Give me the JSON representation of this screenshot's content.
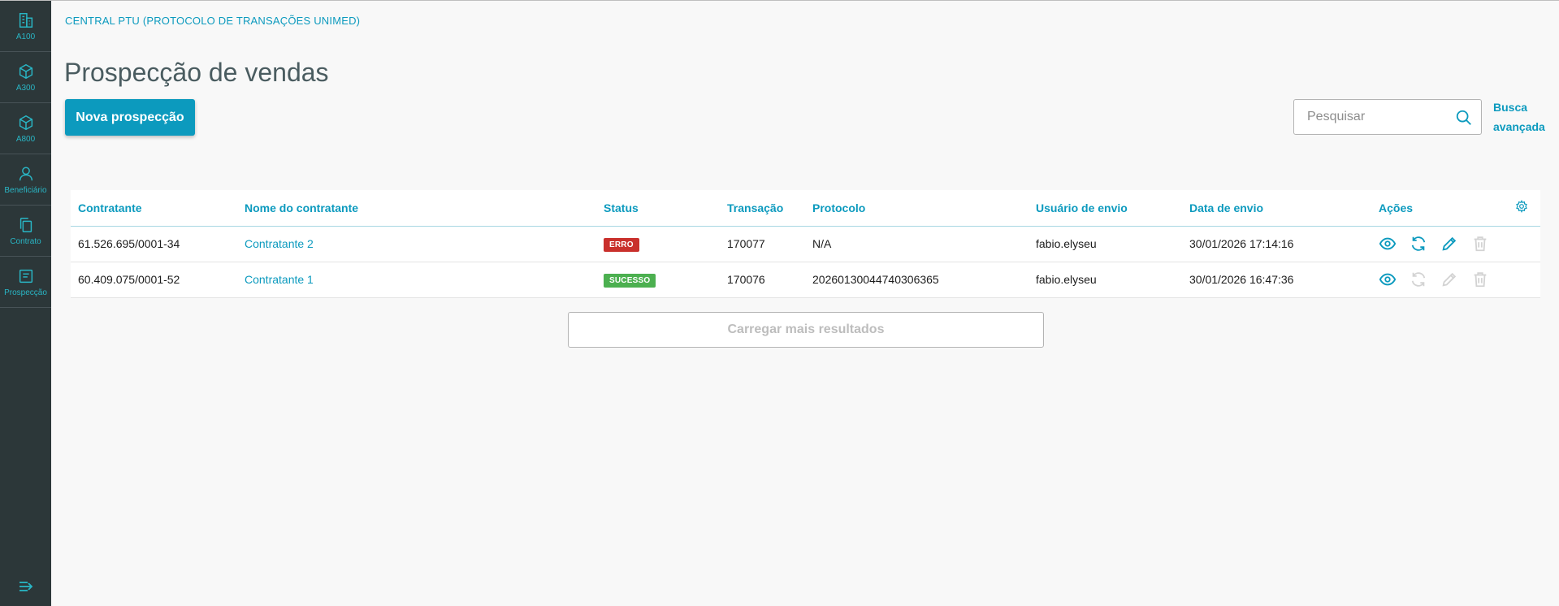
{
  "sidebar": {
    "items": [
      {
        "label": "A100",
        "icon": "building-icon"
      },
      {
        "label": "A300",
        "icon": "box-icon"
      },
      {
        "label": "A800",
        "icon": "box-icon"
      },
      {
        "label": "Beneficiário",
        "icon": "user-icon"
      },
      {
        "label": "Contrato",
        "icon": "copy-icon"
      },
      {
        "label": "Prospecção",
        "icon": "form-icon"
      }
    ],
    "collapse_icon": "collapse-menu-icon"
  },
  "header": {
    "app_title": "CENTRAL PTU (PROTOCOLO DE TRANSAÇÕES UNIMED)",
    "page_title": "Prospecção de vendas"
  },
  "toolbar": {
    "new_button": "Nova prospecção",
    "search_placeholder": "Pesquisar",
    "advanced_search_line1": "Busca",
    "advanced_search_line2": "avançada"
  },
  "table": {
    "columns": [
      "Contratante",
      "Nome do contratante",
      "Status",
      "Transação",
      "Protocolo",
      "Usuário de envio",
      "Data de envio",
      "Ações"
    ],
    "rows": [
      {
        "contratante": "61.526.695/0001-34",
        "nome": "Contratante 2",
        "status": "ERRO",
        "status_color": "#c9302c",
        "transacao": "170077",
        "protocolo": "N/A",
        "usuario": "fabio.elyseu",
        "data": "30/01/2026 17:14:16",
        "actions_enabled": {
          "view": true,
          "resend": true,
          "edit": true,
          "delete": false
        }
      },
      {
        "contratante": "60.409.075/0001-52",
        "nome": "Contratante 1",
        "status": "SUCESSO",
        "status_color": "#4cb050",
        "transacao": "170076",
        "protocolo": "20260130044740306365",
        "usuario": "fabio.elyseu",
        "data": "30/01/2026 16:47:36",
        "actions_enabled": {
          "view": true,
          "resend": false,
          "edit": false,
          "delete": false
        }
      }
    ]
  },
  "load_more": "Carregar mais resultados",
  "colors": {
    "accent": "#0c9abe",
    "sidebar_bg": "#2c3739",
    "error": "#c9302c",
    "success": "#4cb050"
  }
}
